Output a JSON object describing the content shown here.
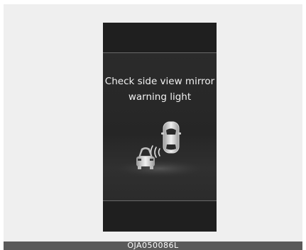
{
  "display": {
    "message_line_1": "Check side view mirror",
    "message_line_2": "warning light",
    "icons": [
      "vehicle-rear-icon",
      "vehicle-top-icon",
      "sensor-wave-icon"
    ]
  },
  "caption": {
    "code": "OJA050086L"
  },
  "colors": {
    "screen": "#1f1f1f",
    "text": "#f2f2f2",
    "caption_bar": "#5a5a5a",
    "frame": "#efefef"
  }
}
